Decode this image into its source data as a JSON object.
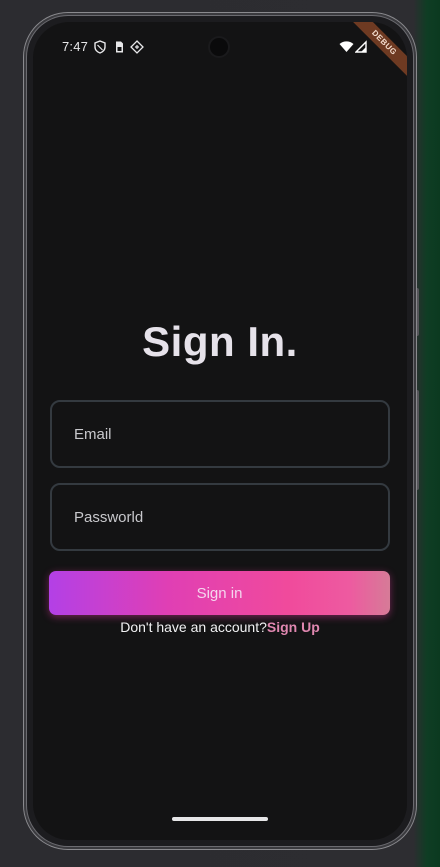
{
  "status_bar": {
    "time": "7:47",
    "left_icons": [
      "shield-icon",
      "sim-card-icon",
      "data-saver-icon"
    ],
    "right_icons": [
      "wifi-icon",
      "signal-icon"
    ]
  },
  "debug_banner": {
    "label": "DEBUG"
  },
  "login": {
    "title": "Sign  In.",
    "email_placeholder": "Email",
    "password_placeholder": "Passworld",
    "signin_label": "Sign in",
    "no_account_text": "Don't have an account?",
    "signup_label": "Sign Up"
  },
  "colors": {
    "background": "#131314",
    "title": "#e6e2ea",
    "field_border": "#343a40",
    "button_gradient_start": "#b340e6",
    "button_gradient_end": "#f04a9c",
    "signup_link": "#e087b0"
  }
}
